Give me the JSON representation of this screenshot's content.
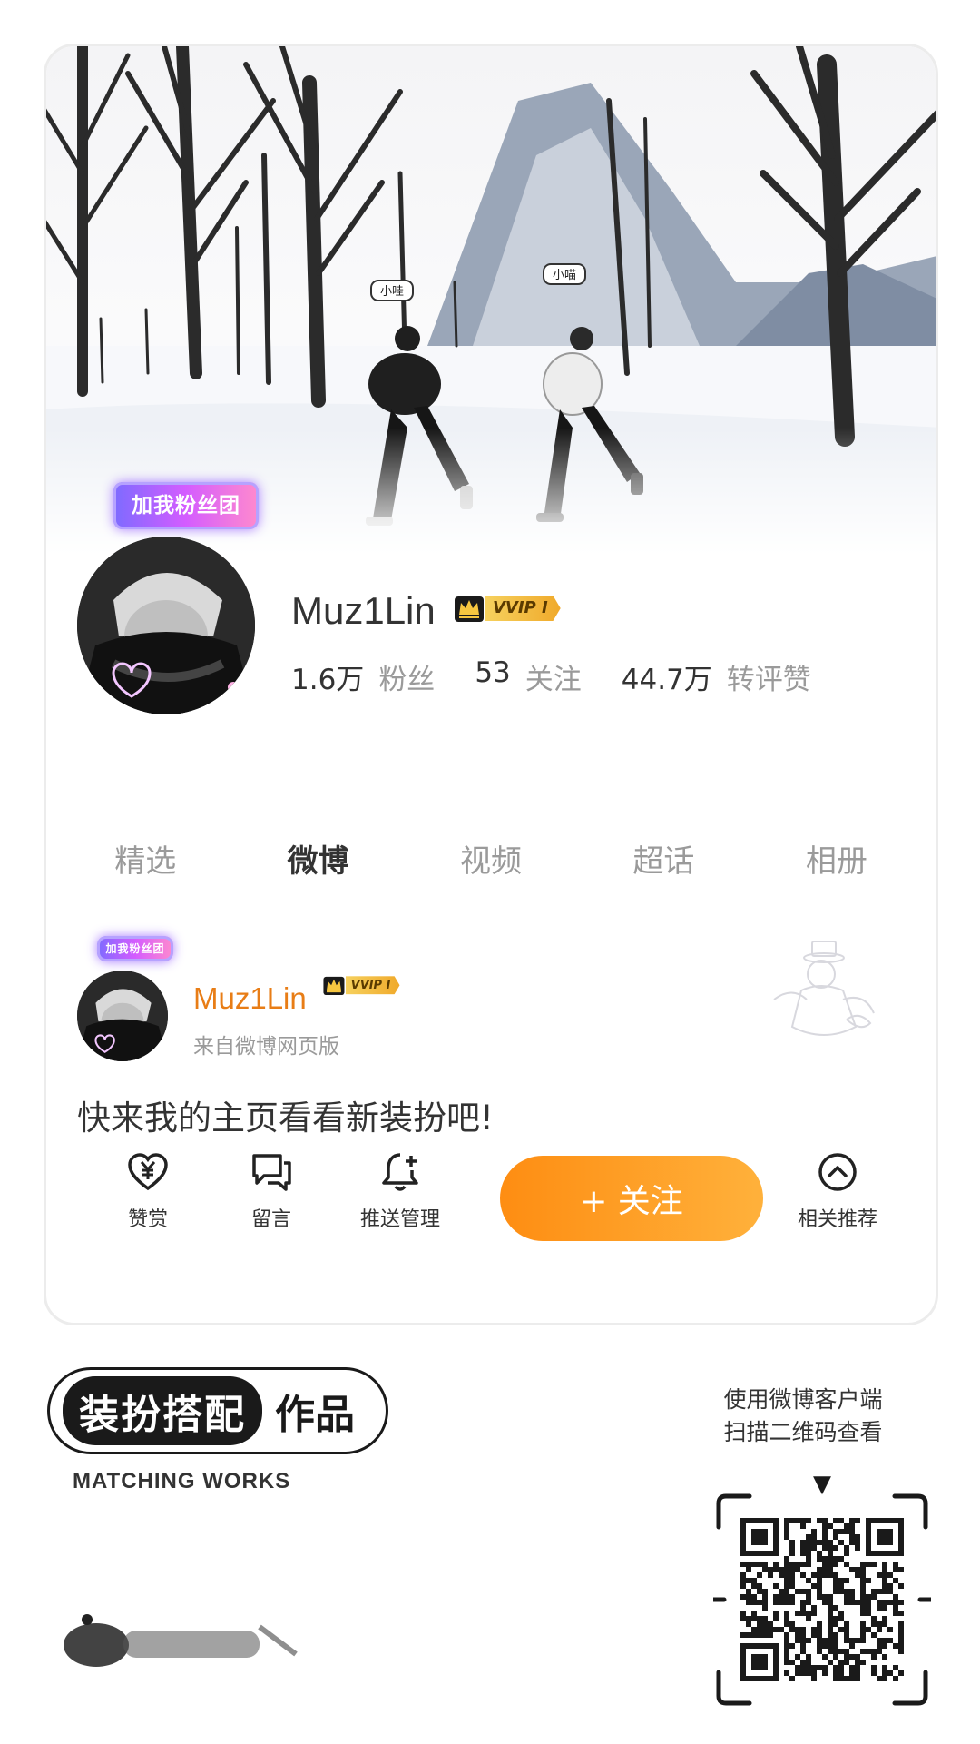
{
  "profile": {
    "fan_badge": "加我粉丝团",
    "name": "Muz1Lin",
    "vip_label": "VVIP I",
    "stats": [
      {
        "num": "1.6万",
        "label": "粉丝"
      },
      {
        "num": "53",
        "label": "关注"
      },
      {
        "num": "44.7万",
        "label": "转评赞"
      }
    ]
  },
  "tabs": [
    "精选",
    "微博",
    "视频",
    "超话",
    "相册"
  ],
  "active_tab": "微博",
  "post": {
    "fan_badge": "加我粉丝团",
    "name": "Muz1Lin",
    "vip_label": "VVIP I",
    "source": "来自微博网页版",
    "text": "快来我的主页看看新装扮吧!"
  },
  "actions": [
    {
      "label": "赞赏",
      "icon": "tip-heart-yen-icon"
    },
    {
      "label": "留言",
      "icon": "comment-bubble-icon"
    },
    {
      "label": "推送管理",
      "icon": "bell-plus-icon"
    },
    {
      "label": "相关推荐",
      "icon": "chevron-up-circle-icon"
    }
  ],
  "follow_button": "+ 关注",
  "footer": {
    "logo_main": "装扮搭配",
    "logo_works": "作品",
    "subtitle": "MATCHING WORKS",
    "scan_line1": "使用微博客户端",
    "scan_line2": "扫描二维码查看"
  },
  "banner": {
    "bubble_left": "小哇",
    "bubble_right": "小喵"
  },
  "colors": {
    "accent_orange": "#fe8d12",
    "name_orange": "#e87d16",
    "muted_text": "#9a9a9a",
    "vip_gold": "#f0a92a"
  }
}
